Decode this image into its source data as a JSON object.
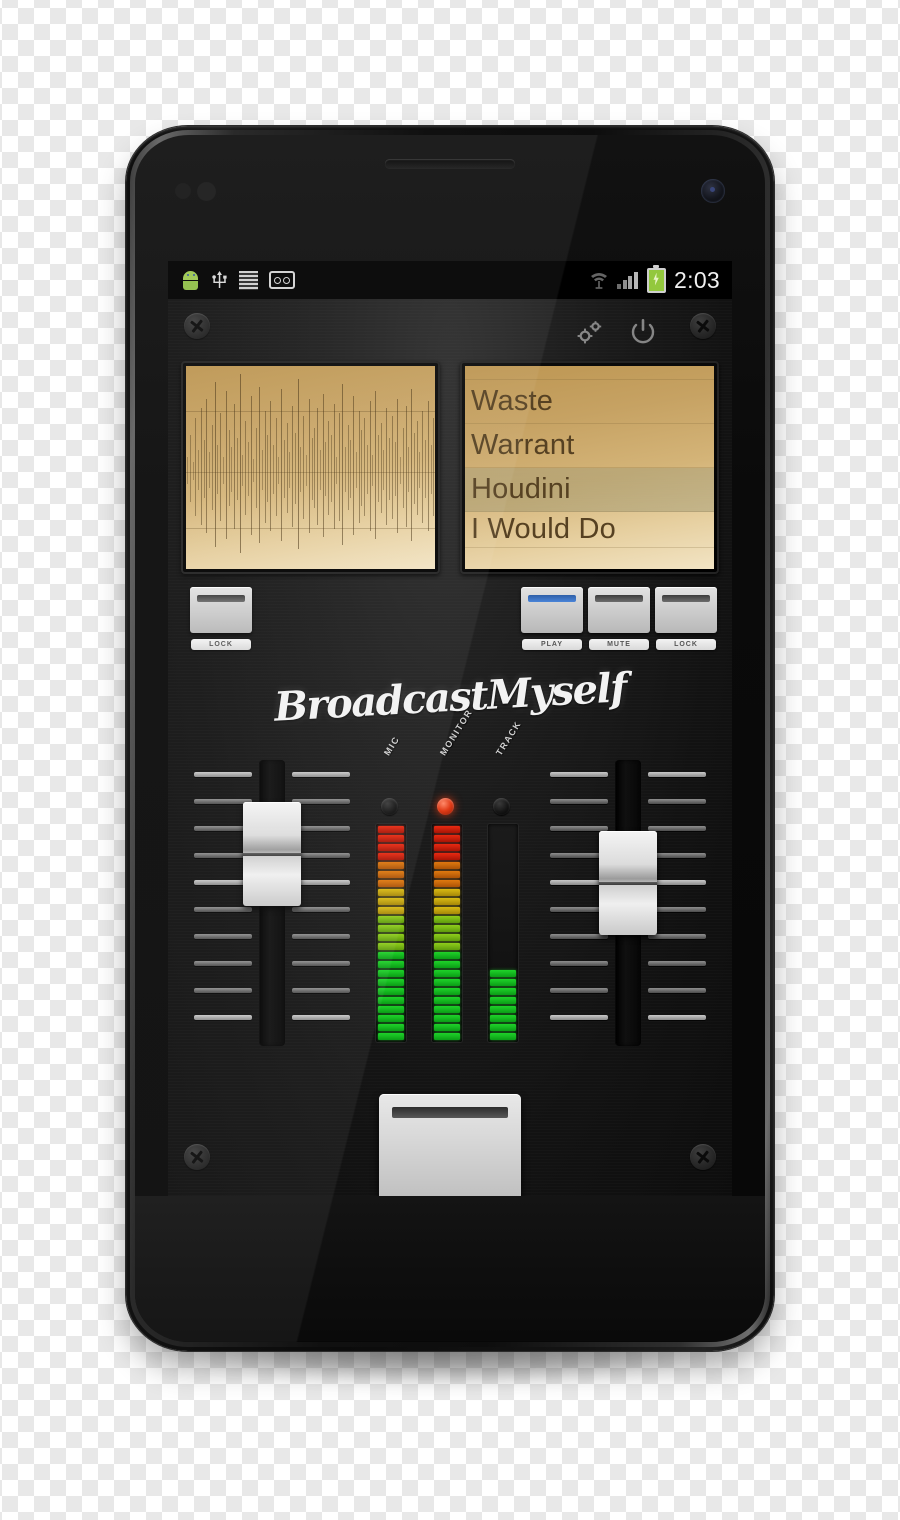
{
  "device": {
    "name": "android-smartphone",
    "earpiece": "earpiece-speaker",
    "camera": "front-camera"
  },
  "status_bar": {
    "clock": "2:03",
    "left_icons": [
      "android-icon",
      "usb-icon",
      "list-icon",
      "badge-icon"
    ],
    "right_icons": [
      "wifi-icon",
      "signal-icon",
      "battery-charging-icon"
    ]
  },
  "app": {
    "title": "BroadcastMyself",
    "toolbar": {
      "settings_label": "settings-gears-icon",
      "power_label": "power-icon"
    },
    "waveform": {
      "label": "Waveform",
      "bg_color": "#d4b478",
      "samples": [
        12,
        30,
        8,
        44,
        18,
        52,
        26,
        60,
        16,
        38,
        74,
        22,
        48,
        12,
        66,
        34,
        20,
        56,
        28,
        80,
        14,
        42,
        24,
        62,
        10,
        36,
        70,
        18,
        50,
        30,
        58,
        22,
        44,
        12,
        68,
        26,
        40,
        16,
        54,
        32,
        76,
        20,
        46,
        14,
        60,
        28,
        36,
        52,
        18,
        64,
        24,
        42,
        30,
        56,
        12,
        48,
        72,
        20,
        38,
        26,
        62,
        16,
        50,
        34,
        44,
        22,
        58,
        14,
        66,
        30,
        40,
        18,
        52,
        28,
        46,
        24,
        60,
        12,
        36,
        54,
        20,
        68,
        32,
        42,
        16,
        50,
        26,
        58,
        22,
        44
      ]
    },
    "playlist": {
      "label": "Playlist",
      "items": [
        {
          "title": "Waste",
          "selected": false
        },
        {
          "title": "Warrant",
          "selected": false
        },
        {
          "title": "Houdini",
          "selected": true
        },
        {
          "title": "I Would Do",
          "selected": false
        }
      ]
    },
    "buttons": [
      {
        "id": "lock-left",
        "label": "LOCK",
        "active": false
      },
      {
        "id": "play",
        "label": "PLAY",
        "active": true
      },
      {
        "id": "mute",
        "label": "MUTE",
        "active": false
      },
      {
        "id": "lock-right",
        "label": "LOCK",
        "active": false
      }
    ],
    "faders": [
      {
        "id": "left-channel-fader",
        "label": "Left Channel",
        "position_pct": 78
      },
      {
        "id": "right-channel-fader",
        "label": "Right Channel",
        "position_pct": 62
      }
    ],
    "meters": [
      {
        "id": "mic",
        "label": "MIC",
        "led_on": false,
        "level_pct": 100
      },
      {
        "id": "monitor",
        "label": "MONITOR",
        "led_on": true,
        "level_pct": 100
      },
      {
        "id": "track",
        "label": "TRACK",
        "led_on": false,
        "level_pct": 32
      }
    ],
    "crossfader": {
      "label": "Crossfader",
      "position_pct": 50
    },
    "screws": [
      "screw-top-left",
      "screw-top-right",
      "screw-bottom-left",
      "screw-bottom-right"
    ]
  }
}
